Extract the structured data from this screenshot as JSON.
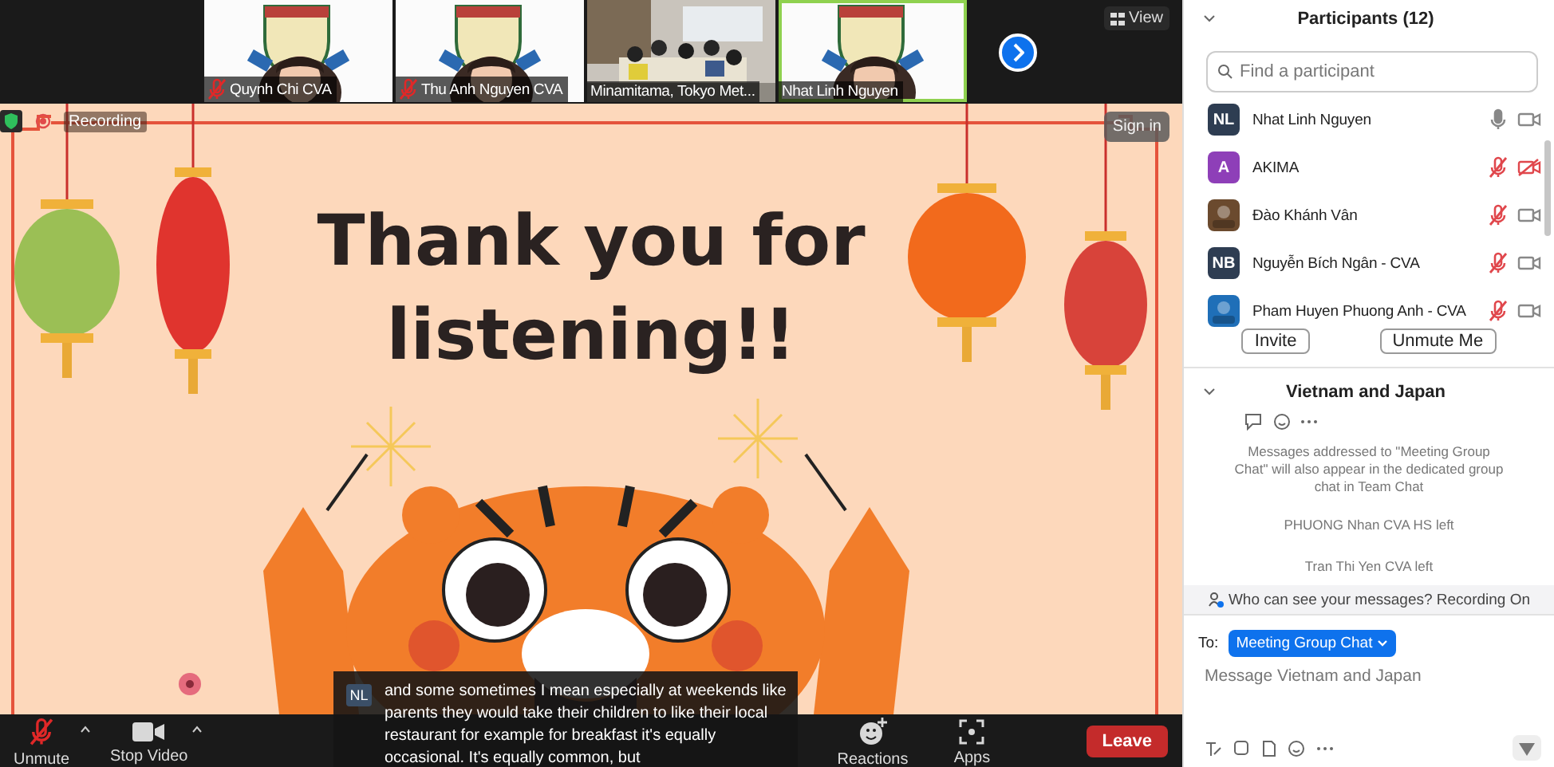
{
  "video_strip": {
    "tiles": [
      {
        "name": "Quynh Chi CVA",
        "muted": true,
        "speaking": false,
        "kind": "person"
      },
      {
        "name": "Thu Anh Nguyen CVA",
        "muted": true,
        "speaking": false,
        "kind": "person"
      },
      {
        "name": "Minamitama, Tokyo Met...",
        "muted": false,
        "speaking": false,
        "kind": "room"
      },
      {
        "name": "Nhat Linh Nguyen",
        "muted": false,
        "speaking": true,
        "kind": "person"
      }
    ],
    "view_label": "View"
  },
  "recording": {
    "label": "Recording"
  },
  "sign_in": "Sign in",
  "slide": {
    "title_lines": [
      "Thank you for",
      "listening!!"
    ]
  },
  "caption": {
    "avatar": "NL",
    "text": "and some sometimes I mean especially at weekends like parents they would take their children to like their local restaurant for example for breakfast it's equally occasional. It's equally common, but"
  },
  "toolbar": {
    "buttons": [
      {
        "label": "Unmute",
        "kind": "mic",
        "muted": true
      },
      {
        "label": "Stop Video",
        "kind": "video"
      },
      {
        "label": "Reactions",
        "kind": "reactions"
      },
      {
        "label": "Apps",
        "kind": "apps"
      }
    ],
    "leave": "Leave"
  },
  "participants": {
    "title": "Participants (12)",
    "placeholder": "Find a participant",
    "items": [
      {
        "name": "Nhat Linh Nguyen",
        "kind": "initials",
        "initials": "NL",
        "color": "#2e3d52",
        "mic_muted": false,
        "video_off": false
      },
      {
        "name": "AKIMA",
        "kind": "initials",
        "initials": "A",
        "color": "#8e3fb8",
        "mic_muted": true,
        "video_off": true
      },
      {
        "name": "Đào Khánh Vân",
        "kind": "picture",
        "color": "#6b4a2e",
        "mic_muted": true,
        "video_off": false
      },
      {
        "name": "Nguyễn Bích Ngân - CVA",
        "kind": "initials",
        "initials": "NB",
        "color": "#2e3d52",
        "mic_muted": true,
        "video_off": false
      },
      {
        "name": "Pham Huyen Phuong Anh - CVA",
        "kind": "picture",
        "color": "#1f6fb8",
        "mic_muted": true,
        "video_off": false
      }
    ],
    "buttons": [
      "Invite",
      "Unmute Me"
    ]
  },
  "chat": {
    "title": "Vietnam and Japan",
    "notice": "Messages addressed to \"Meeting Group Chat\" will also appear in the dedicated group chat in Team Chat",
    "events": [
      "PHUONG Nhan CVA HS left",
      "Tran Thi Yen CVA left"
    ],
    "privacy": "Who can see your messages? Recording On",
    "to_label": "To:",
    "recipient": "Meeting Group Chat",
    "placeholder": "Message Vietnam and Japan"
  }
}
